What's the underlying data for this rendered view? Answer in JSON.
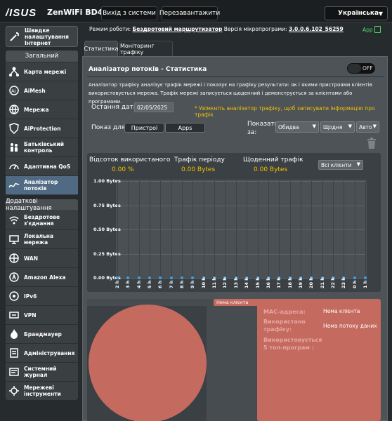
{
  "header": {
    "brand": "/ISUS",
    "model": "ZenWiFi BD4",
    "logout_label": "Вихід з системи",
    "reboot_label": "Перезавантажити",
    "language": "Українська"
  },
  "status": {
    "mode_label": "Режим роботи:",
    "mode_value": "Бездротовий маршрутизатор",
    "firmware_label": "Версія мікропрограми:",
    "firmware_value": "3.0.0.6.102_56259",
    "app_label": "App"
  },
  "sidebar": {
    "quick_setup": "Швидке налаштування Інтернет",
    "general_header": "Загальний",
    "general_items": [
      {
        "label": "Карта мережі",
        "icon": "network-map-icon"
      },
      {
        "label": "AiMesh",
        "icon": "aimesh-icon"
      },
      {
        "label": "Мережа",
        "icon": "globe-icon"
      },
      {
        "label": "AiProtection",
        "icon": "shield-icon"
      },
      {
        "label": "Батьківський контроль",
        "icon": "family-icon"
      },
      {
        "label": "Адаптивна QoS",
        "icon": "qos-icon"
      },
      {
        "label": "Аналізатор потоків",
        "icon": "traffic-icon"
      }
    ],
    "advanced_header": "Додаткові налаштування",
    "advanced_items": [
      {
        "label": "Бездротове з'єднання",
        "icon": "wifi-icon"
      },
      {
        "label": "Локальна мережа",
        "icon": "lan-icon"
      },
      {
        "label": "WAN",
        "icon": "wan-globe-icon"
      },
      {
        "label": "Amazon Alexa",
        "icon": "alexa-icon"
      },
      {
        "label": "IPv6",
        "icon": "ipv6-icon"
      },
      {
        "label": "VPN",
        "icon": "vpn-icon"
      },
      {
        "label": "Брандмауер",
        "icon": "firewall-icon"
      },
      {
        "label": "Адміністрування",
        "icon": "admin-icon"
      },
      {
        "label": "Системний журнал",
        "icon": "log-icon"
      },
      {
        "label": "Мережеві інструменти",
        "icon": "tools-icon"
      }
    ]
  },
  "tabs": [
    "Статистика",
    "Моніторинг трафіку"
  ],
  "panel": {
    "title": "Аналізатор потоків - Статистика",
    "toggle_label": "OFF",
    "description": "Аналізатор трафіку аналізує трафік мережі і показує на графіку результати: як і якими пристроями клієнтів використовується мережа. Трафік мережі записується щоденний і демонструється за клієнтами або програмами.",
    "last_date_label": "Остання дата",
    "last_date_value": "02/05/2025",
    "warning": "* Увімкніть аналізатор трафіку, щоб записувати інформацію про трафік",
    "show_for_label": "Показ для:",
    "devices_btn": "Пристрої",
    "apps_btn": "Apps",
    "show_label": "Показати за:",
    "select_direction": "Обидва",
    "select_period": "Щодня",
    "select_units": "Авто"
  },
  "stats": {
    "pct_label": "Відсоток використаного",
    "pct_value": "0.00 %",
    "period_label": "Трафік періоду",
    "period_value": "0.00 Bytes",
    "daily_label": "Щоденний трафік",
    "daily_value": "0.00 Bytes",
    "client_select": "Всі клієнти"
  },
  "chart_data": {
    "type": "line",
    "x": [
      "2 h",
      "3 h",
      "4 h",
      "5 h",
      "6 h",
      "7 h",
      "8 h",
      "9 h",
      "10 h",
      "11 h",
      "12 h",
      "13 h",
      "14 h",
      "15 h",
      "16 h",
      "17 h",
      "18 h",
      "19 h",
      "20 h",
      "21 h",
      "22 h",
      "23 h",
      "0 h",
      "1 h"
    ],
    "series": [
      {
        "values": [
          0,
          0,
          0,
          0,
          0,
          0,
          0,
          0,
          0,
          0,
          0,
          0,
          0,
          0,
          0,
          0,
          0,
          0,
          0,
          0,
          0,
          0,
          0,
          0
        ]
      }
    ],
    "yticks": [
      "1.00 Bytes",
      "0.75 Bytes",
      "0.50 Bytes",
      "0.25 Bytes",
      "0.00 Bytes"
    ],
    "ylim": [
      0,
      1
    ],
    "grid": true
  },
  "pie": {
    "tag": "Нема клієнта",
    "mac_label": "MAC-адреса:",
    "mac_value": "Нема клієнта",
    "traffic_label": "Використано трафіку:",
    "traffic_value": "Нема потоку даних",
    "top_label": "Використовується 5 топ-програм :",
    "color": "#c46a5f"
  }
}
